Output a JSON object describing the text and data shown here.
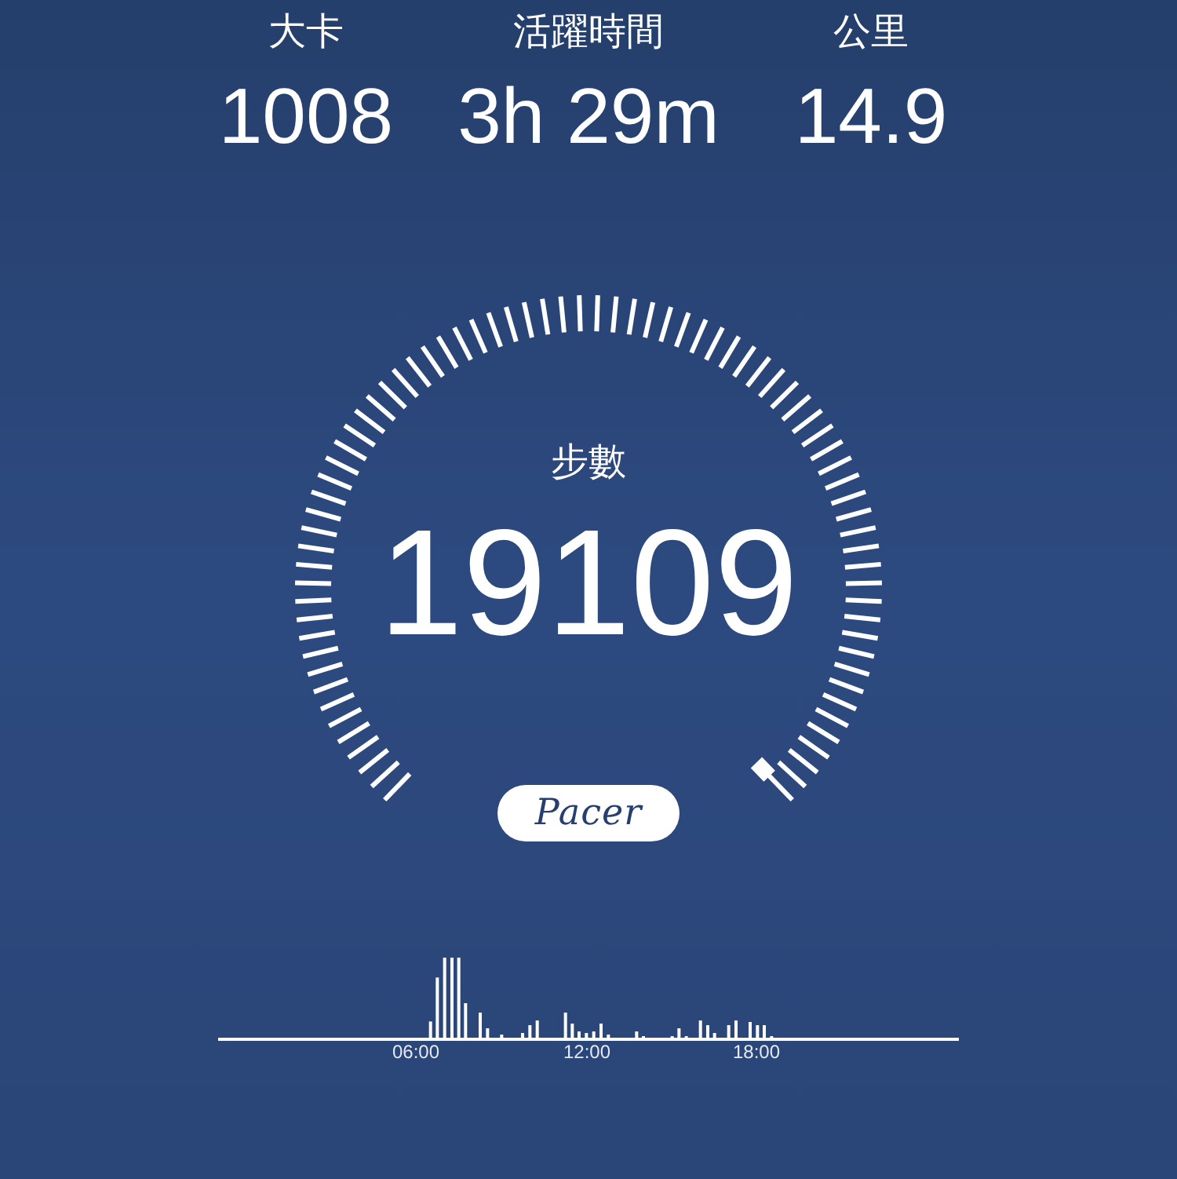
{
  "stats": [
    {
      "label": "大卡",
      "value": "1008"
    },
    {
      "label": "活躍時間",
      "value": "3h 29m"
    },
    {
      "label": "公里",
      "value": "14.9"
    }
  ],
  "steps": {
    "label": "步數",
    "value": "19109"
  },
  "logo": "Pacer",
  "activity_chart": {
    "kind": "picture",
    "time_labels": [
      "06:00",
      "12:00",
      "18:00"
    ]
  }
}
